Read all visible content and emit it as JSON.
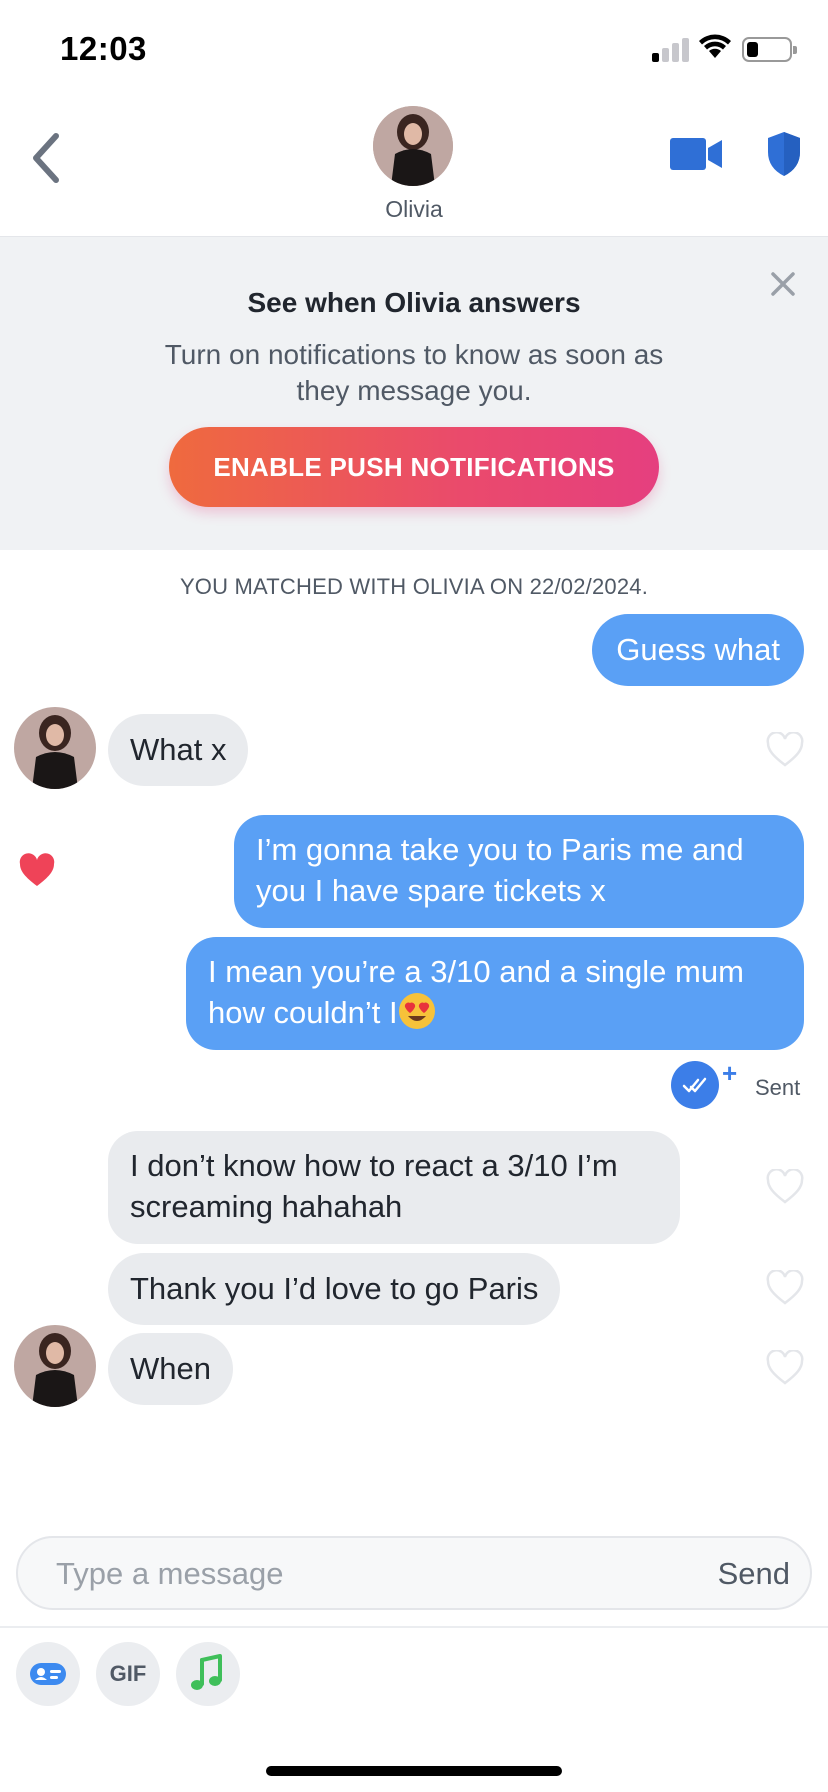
{
  "status": {
    "time": "12:03"
  },
  "header": {
    "name": "Olivia"
  },
  "banner": {
    "title": "See when Olivia answers",
    "text": "Turn on notifications to know as soon as they message you.",
    "button": "ENABLE PUSH NOTIFICATIONS"
  },
  "chat": {
    "match_note": "YOU MATCHED WITH OLIVIA ON 22/02/2024.",
    "messages": [
      {
        "from": "me",
        "text": "Guess what"
      },
      {
        "from": "olivia",
        "text": "What x"
      },
      {
        "from": "me",
        "text": "I’m gonna take you to Paris me and you I have spare tickets x",
        "liked": true
      },
      {
        "from": "me",
        "text": "I mean you’re a 3/10 and a single mum how couldn’t I",
        "emoji": "heart-eyes-emoji"
      },
      {
        "from": "olivia",
        "text": "I don’t know how to react a 3/10 I’m screaming hahahah"
      },
      {
        "from": "olivia",
        "text": "Thank you I’d love to go Paris"
      },
      {
        "from": "olivia",
        "text": "When"
      }
    ],
    "sent_status": "Sent",
    "sent_plus": "+"
  },
  "composer": {
    "placeholder": "Type a message",
    "send": "Send",
    "tools": [
      {
        "icon": "id-card-icon"
      },
      {
        "label": "GIF"
      },
      {
        "icon": "music-note-icon"
      }
    ]
  },
  "colors": {
    "outgoing_bubble": "#5aa0f5",
    "incoming_bubble": "#e9ebee",
    "accent_blue": "#3c7ee8",
    "like_heart": "#ef4358",
    "button_gradient_start": "#ef6a3e",
    "button_gradient_end": "#e53f7f"
  }
}
